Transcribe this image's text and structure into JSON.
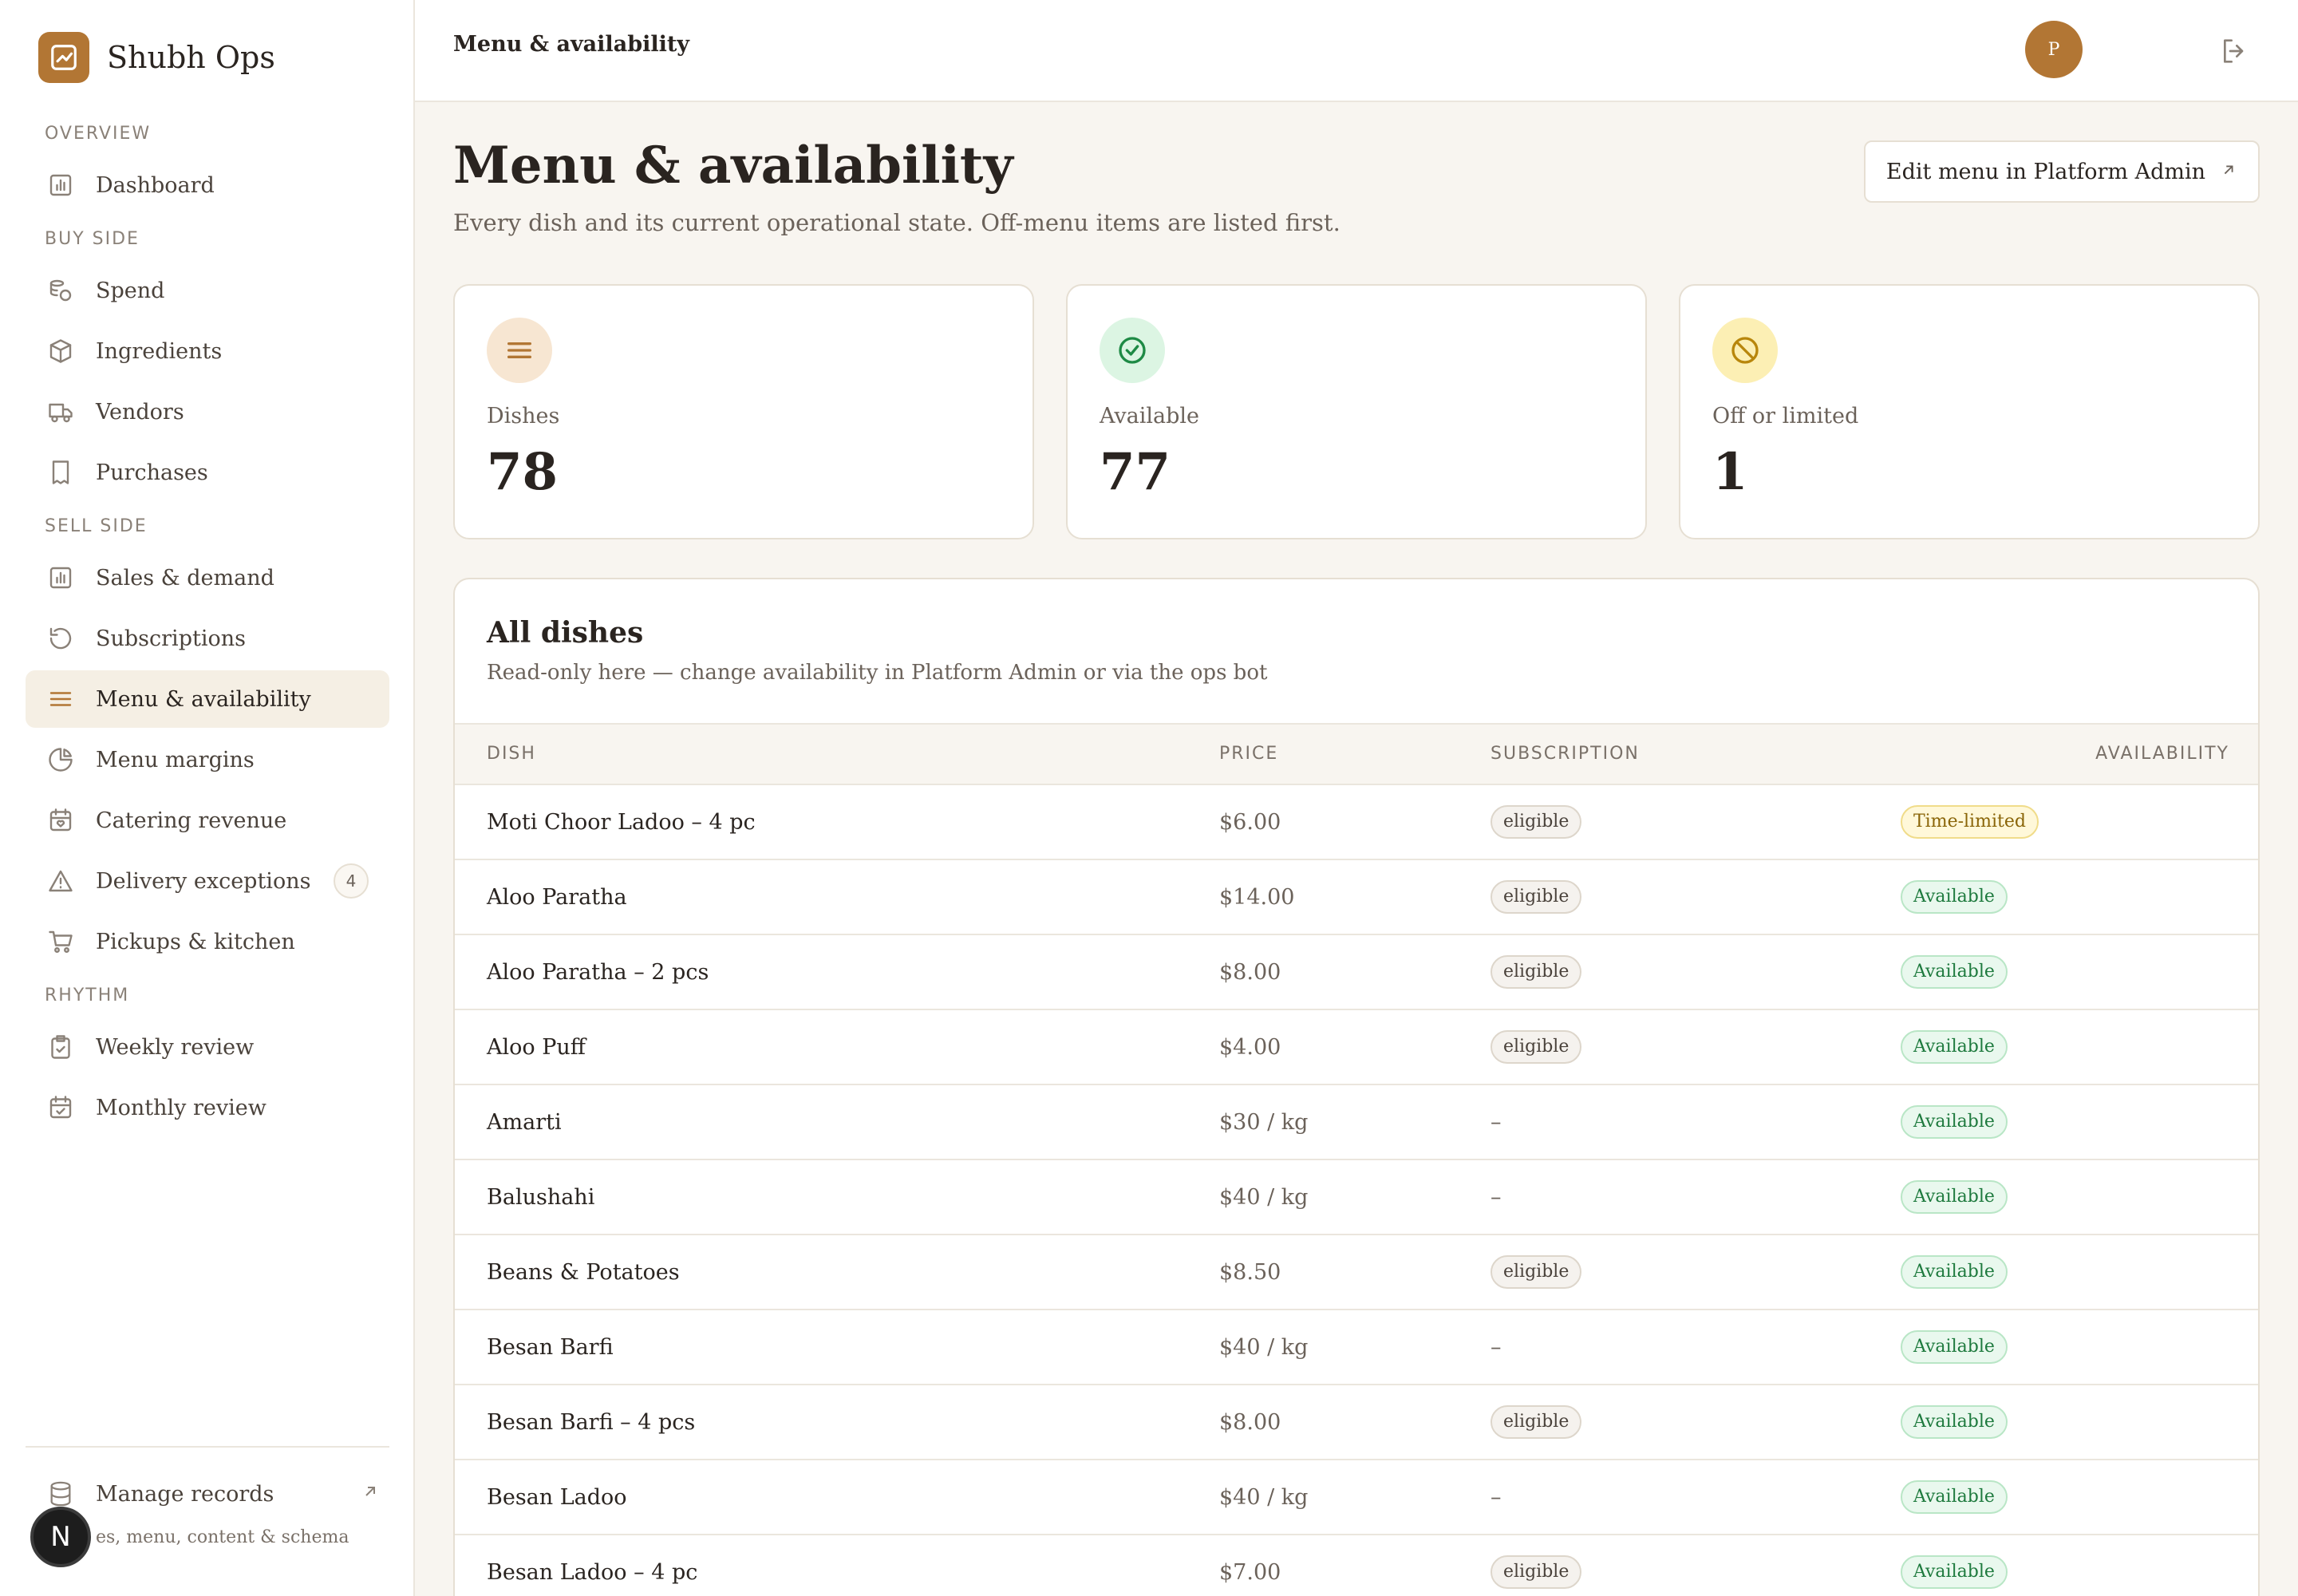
{
  "app": {
    "name": "Shubh Ops"
  },
  "sidebar": {
    "sections": [
      {
        "label": "OVERVIEW",
        "items": [
          {
            "label": "Dashboard",
            "icon": "bar-chart-icon"
          }
        ]
      },
      {
        "label": "BUY SIDE",
        "items": [
          {
            "label": "Spend",
            "icon": "coins-icon"
          },
          {
            "label": "Ingredients",
            "icon": "package-icon"
          },
          {
            "label": "Vendors",
            "icon": "truck-icon"
          },
          {
            "label": "Purchases",
            "icon": "receipt-icon"
          }
        ]
      },
      {
        "label": "SELL SIDE",
        "items": [
          {
            "label": "Sales & demand",
            "icon": "bar-chart-icon"
          },
          {
            "label": "Subscriptions",
            "icon": "refresh-icon"
          },
          {
            "label": "Menu & availability",
            "icon": "menu-lines-icon",
            "active": true
          },
          {
            "label": "Menu margins",
            "icon": "pie-chart-icon"
          },
          {
            "label": "Catering revenue",
            "icon": "calendar-heart-icon"
          },
          {
            "label": "Delivery exceptions",
            "icon": "warning-icon",
            "badge": "4"
          },
          {
            "label": "Pickups & kitchen",
            "icon": "cart-icon"
          }
        ]
      },
      {
        "label": "RHYTHM",
        "items": [
          {
            "label": "Weekly review",
            "icon": "clipboard-check-icon"
          },
          {
            "label": "Monthly review",
            "icon": "calendar-check-icon"
          }
        ]
      }
    ],
    "manage": {
      "label": "Manage records",
      "sub": "es, menu, content & schema"
    },
    "n_badge": "N"
  },
  "topbar": {
    "title": "Menu & availability",
    "avatar": "P"
  },
  "page": {
    "title": "Menu & availability",
    "subtitle": "Every dish and its current operational state. Off-menu items are listed first.",
    "edit_button": "Edit menu in Platform Admin"
  },
  "stats": [
    {
      "label": "Dishes",
      "value": "78",
      "icon": "menu-lines-icon",
      "bg": "#f7e6d2",
      "fg": "#b27634"
    },
    {
      "label": "Available",
      "value": "77",
      "icon": "check-circle-icon",
      "bg": "#dcf5e3",
      "fg": "#1e8a45"
    },
    {
      "label": "Off or limited",
      "value": "1",
      "icon": "ban-icon",
      "bg": "#fcefb4",
      "fg": "#b8860b"
    }
  ],
  "table": {
    "title": "All dishes",
    "subtitle": "Read-only here — change availability in Platform Admin or via the ops bot",
    "headers": {
      "dish": "DISH",
      "price": "PRICE",
      "subscription": "SUBSCRIPTION",
      "availability": "AVAILABILITY"
    },
    "rows": [
      {
        "dish": "Moti Choor Ladoo – 4 pc",
        "price": "$6.00",
        "subscription": "eligible",
        "availability": "Time-limited"
      },
      {
        "dish": "Aloo Paratha",
        "price": "$14.00",
        "subscription": "eligible",
        "availability": "Available"
      },
      {
        "dish": "Aloo Paratha – 2 pcs",
        "price": "$8.00",
        "subscription": "eligible",
        "availability": "Available"
      },
      {
        "dish": "Aloo Puff",
        "price": "$4.00",
        "subscription": "eligible",
        "availability": "Available"
      },
      {
        "dish": "Amarti",
        "price": "$30 / kg",
        "subscription": "–",
        "availability": "Available"
      },
      {
        "dish": "Balushahi",
        "price": "$40 / kg",
        "subscription": "–",
        "availability": "Available"
      },
      {
        "dish": "Beans & Potatoes",
        "price": "$8.50",
        "subscription": "eligible",
        "availability": "Available"
      },
      {
        "dish": "Besan Barfi",
        "price": "$40 / kg",
        "subscription": "–",
        "availability": "Available"
      },
      {
        "dish": "Besan Barfi – 4 pcs",
        "price": "$8.00",
        "subscription": "eligible",
        "availability": "Available"
      },
      {
        "dish": "Besan Ladoo",
        "price": "$40 / kg",
        "subscription": "–",
        "availability": "Available"
      },
      {
        "dish": "Besan Ladoo – 4 pc",
        "price": "$7.00",
        "subscription": "eligible",
        "availability": "Available"
      }
    ]
  }
}
